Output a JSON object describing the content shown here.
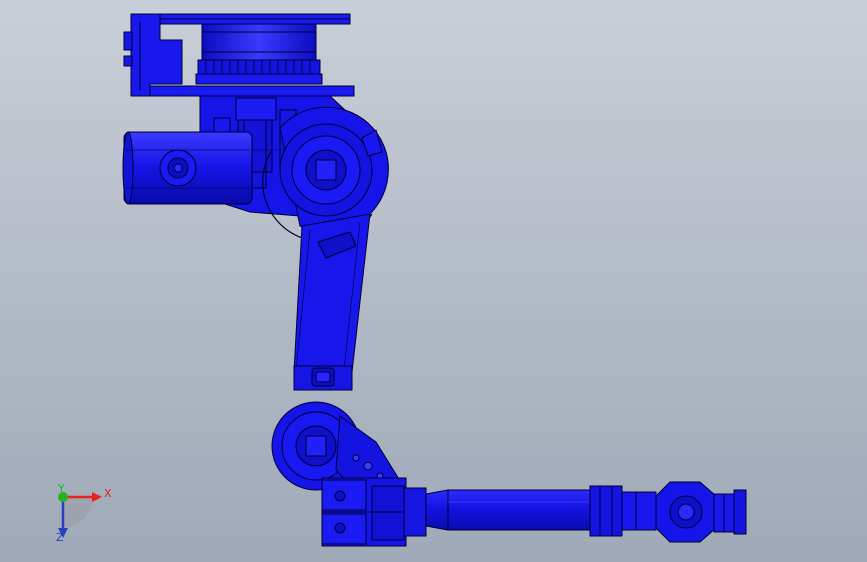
{
  "viewport": {
    "background_top": "#c9cfd8",
    "background_bottom": "#9fa9b8"
  },
  "model": {
    "part_color": "#1515ee",
    "edge_color": "#000033",
    "highlight_color": "#4848ff"
  },
  "triad": {
    "x_label": "X",
    "y_label": "Y",
    "z_label": "Z",
    "x_color": "#e8211a",
    "y_color": "#22b322",
    "z_color": "#2a3fbf"
  }
}
